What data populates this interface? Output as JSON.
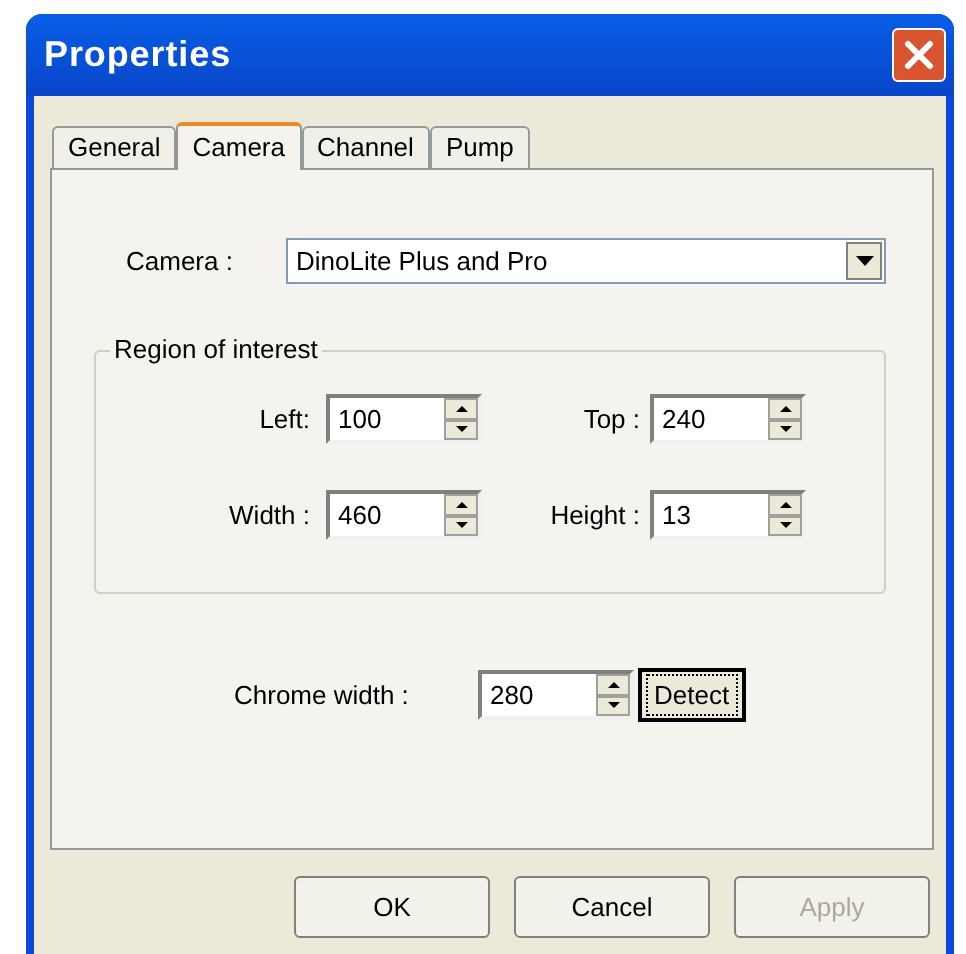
{
  "window": {
    "title": "Properties"
  },
  "tabs": [
    {
      "label": "General",
      "selected": false
    },
    {
      "label": "Camera",
      "selected": true
    },
    {
      "label": "Channel",
      "selected": false
    },
    {
      "label": "Pump",
      "selected": false
    }
  ],
  "camera": {
    "label": "Camera :",
    "value": "DinoLite Plus and Pro"
  },
  "region_of_interest": {
    "title": "Region of interest",
    "fields": [
      {
        "label": "Left:",
        "value": "100"
      },
      {
        "label": "Top :",
        "value": "240"
      },
      {
        "label": "Width :",
        "value": "460"
      },
      {
        "label": "Height :",
        "value": "13"
      }
    ]
  },
  "chrome_width": {
    "label": "Chrome width :",
    "value": "280",
    "button": {
      "label": "Detect",
      "focused": true
    }
  },
  "buttons": [
    {
      "label": "OK",
      "disabled": false
    },
    {
      "label": "Cancel",
      "disabled": false
    },
    {
      "label": "Apply",
      "disabled": true
    }
  ]
}
